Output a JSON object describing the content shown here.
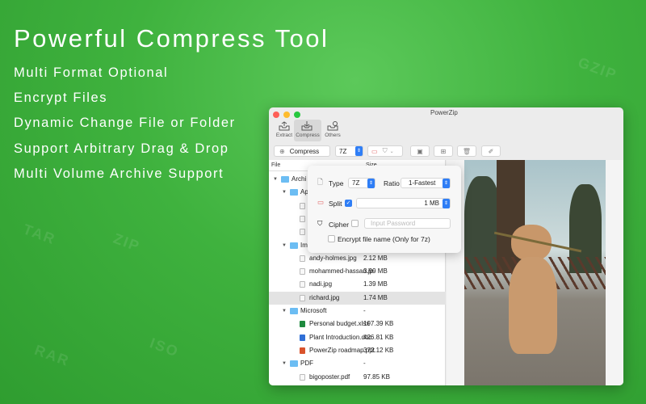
{
  "hero": {
    "title": "Powerful Compress Tool",
    "features": [
      "Multi Format Optional",
      "Encrypt Files",
      "Dynamic Change File or Folder",
      "Support Arbitrary Drag & Drop",
      "Multi Volume Archive Support"
    ]
  },
  "watermarks": [
    "TAR",
    "ZIP",
    "RAR",
    "ISO",
    "GZIP"
  ],
  "window": {
    "title": "PowerZip",
    "tabs": [
      "Extract",
      "Compress",
      "Others"
    ],
    "toolbar": {
      "action": "Compress",
      "format": "7Z"
    },
    "columns": {
      "file": "File",
      "size": "Size"
    },
    "rows": [
      {
        "name": "Archi",
        "size": "",
        "level": 0,
        "type": "folder"
      },
      {
        "name": "Ap",
        "size": "",
        "level": 1,
        "type": "folder"
      },
      {
        "name": "",
        "size": "",
        "level": 2,
        "type": "file"
      },
      {
        "name": "",
        "size": "",
        "level": 2,
        "type": "file"
      },
      {
        "name": "",
        "size": "",
        "level": 2,
        "type": "file"
      },
      {
        "name": "Im",
        "size": "",
        "level": 1,
        "type": "folder"
      },
      {
        "name": "andy-holmes.jpg",
        "size": "2.12 MB",
        "level": 2,
        "type": "file"
      },
      {
        "name": "mohammed-hassan.jp",
        "size": "3.99 MB",
        "level": 2,
        "type": "file"
      },
      {
        "name": "nadi.jpg",
        "size": "1.39 MB",
        "level": 2,
        "type": "file"
      },
      {
        "name": "richard.jpg",
        "size": "1.74 MB",
        "level": 2,
        "type": "file",
        "selected": true
      },
      {
        "name": "Microsoft",
        "size": "-",
        "level": 1,
        "type": "folder"
      },
      {
        "name": "Personal budget.xlsx",
        "size": "197.39 KB",
        "level": 2,
        "type": "xlsx"
      },
      {
        "name": "Plant Introduction.doc",
        "size": "426.81 KB",
        "level": 2,
        "type": "doc"
      },
      {
        "name": "PowerZip roadmap.ppt",
        "size": "372.12 KB",
        "level": 2,
        "type": "ppt"
      },
      {
        "name": "PDF",
        "size": "-",
        "level": 1,
        "type": "folder"
      },
      {
        "name": "bigoposter.pdf",
        "size": "97.85 KB",
        "level": 2,
        "type": "file"
      }
    ]
  },
  "popover": {
    "type_label": "Type",
    "type_value": "7Z",
    "ratio_label": "Ratio",
    "ratio_value": "1-Fastest",
    "split_label": "Split",
    "split_checked": true,
    "split_value": "1 MB",
    "cipher_label": "Cipher",
    "cipher_checked": false,
    "password_placeholder": "Input Password",
    "encrypt_name_label": "Encrypt file name (Only for 7z)",
    "encrypt_name_checked": false
  },
  "colors": {
    "accent": "#2f7ef6",
    "bg": "#3fb23e"
  }
}
